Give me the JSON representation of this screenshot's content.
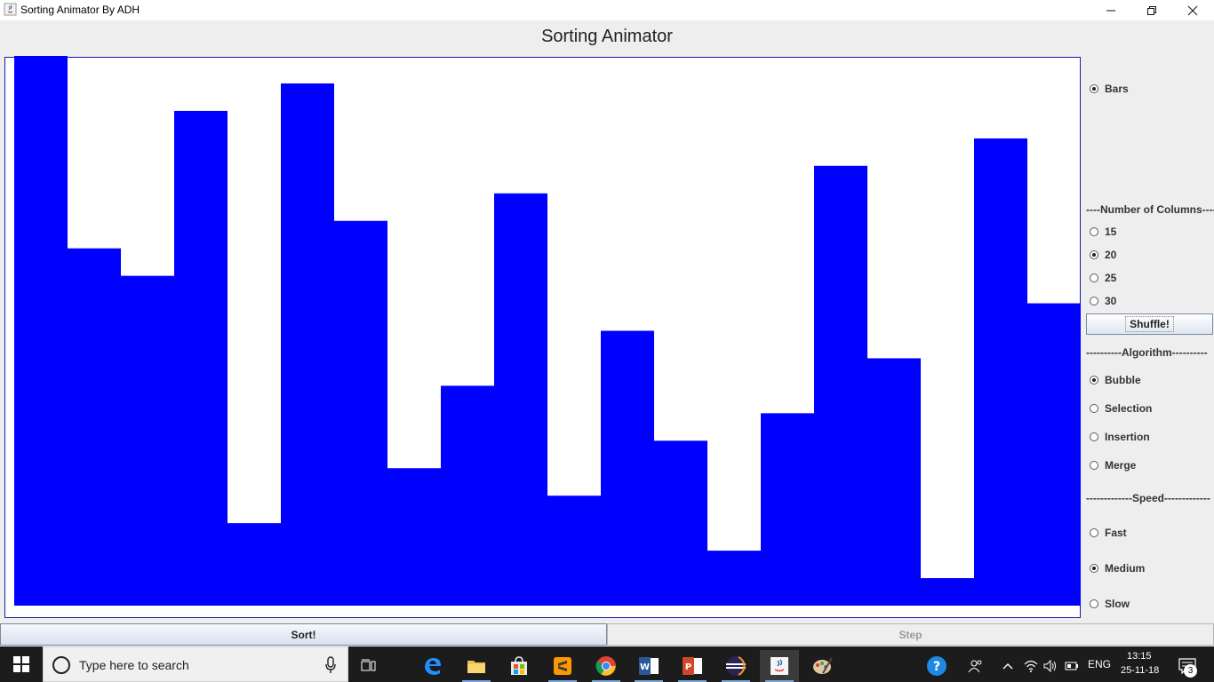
{
  "window": {
    "title": "Sorting Animator By ADH"
  },
  "app": {
    "heading": "Sorting Animator"
  },
  "bars": {
    "color": "#0000ff",
    "count": 20,
    "values": [
      100,
      65,
      60,
      90,
      15,
      95,
      70,
      25,
      40,
      75,
      20,
      50,
      30,
      10,
      35,
      80,
      45,
      5,
      85,
      55
    ],
    "max": 100
  },
  "display": {
    "options": [
      {
        "label": "Bars",
        "selected": true
      }
    ]
  },
  "columns": {
    "header": "----Number of Columns-----",
    "options": [
      {
        "label": "15",
        "selected": false
      },
      {
        "label": "20",
        "selected": true
      },
      {
        "label": "25",
        "selected": false
      },
      {
        "label": "30",
        "selected": false
      }
    ],
    "shuffle_label": "Shuffle!"
  },
  "algorithm": {
    "header": "----------Algorithm----------",
    "options": [
      {
        "label": "Bubble",
        "selected": true
      },
      {
        "label": "Selection",
        "selected": false
      },
      {
        "label": "Insertion",
        "selected": false
      },
      {
        "label": "Merge",
        "selected": false
      }
    ]
  },
  "speed": {
    "header": "-------------Speed-------------",
    "options": [
      {
        "label": "Fast",
        "selected": false
      },
      {
        "label": "Medium",
        "selected": true
      },
      {
        "label": "Slow",
        "selected": false
      }
    ]
  },
  "actions": {
    "sort_label": "Sort!",
    "step_label": "Step"
  },
  "taskbar": {
    "search_placeholder": "Type here to search",
    "icons": [
      "task-view-icon",
      "edge-icon",
      "file-explorer-icon",
      "store-icon",
      "sublime-text-icon",
      "chrome-icon",
      "word-icon",
      "powerpoint-icon",
      "eclipse-icon",
      "java-icon",
      "paint-icon"
    ],
    "language": "ENG",
    "time": "13:15",
    "date": "25-11-18",
    "notification_count": "3"
  }
}
